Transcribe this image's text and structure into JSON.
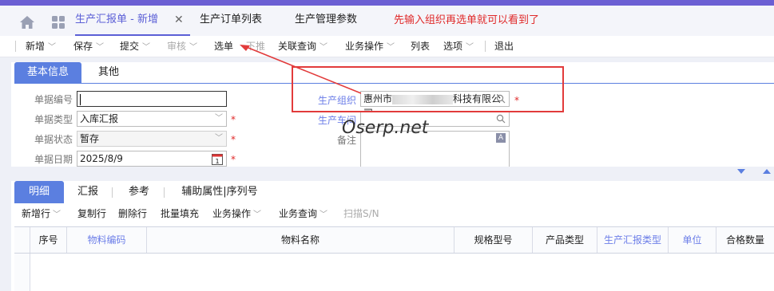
{
  "tabbar": {
    "home_icon": "home-icon",
    "apps_icon": "apps-grid-icon",
    "tabs": [
      {
        "label": "生产汇报单 - 新增",
        "active": true
      },
      {
        "label": "生产订单列表",
        "active": false
      },
      {
        "label": "生产管理参数",
        "active": false
      }
    ],
    "close_glyph": "✕",
    "tip": "先输入组织再选单就可以看到了"
  },
  "toolbar": {
    "items": [
      {
        "label": "新增",
        "chevron": true,
        "disabled": false
      },
      {
        "label": "保存",
        "chevron": true,
        "disabled": false
      },
      {
        "label": "提交",
        "chevron": true,
        "disabled": false
      },
      {
        "label": "审核",
        "chevron": true,
        "disabled": true
      },
      {
        "label": "选单",
        "chevron": false,
        "disabled": false
      },
      {
        "label": "下推",
        "chevron": false,
        "disabled": true
      },
      {
        "label": "关联查询",
        "chevron": true,
        "disabled": false
      },
      {
        "label": "业务操作",
        "chevron": true,
        "disabled": false
      },
      {
        "label": "列表",
        "chevron": false,
        "disabled": false
      },
      {
        "label": "选项",
        "chevron": true,
        "disabled": false
      },
      {
        "label": "退出",
        "chevron": false,
        "disabled": false
      }
    ]
  },
  "header_tabs": [
    "基本信息",
    "其他"
  ],
  "form": {
    "bill_no_label": "单据编号",
    "bill_no_value": "",
    "bill_type_label": "单据类型",
    "bill_type_value": "入库汇报",
    "bill_status_label": "单据状态",
    "bill_status_value": "暂存",
    "bill_date_label": "单据日期",
    "bill_date_value": "2025/8/9",
    "calendar_day": "1",
    "org_label": "生产组织",
    "org_value_prefix": "惠州市",
    "org_value_suffix": "科技有限公司",
    "workshop_label": "生产车间",
    "workshop_value": "",
    "remark_label": "备注",
    "required_mark": "*"
  },
  "watermark": "Oserp.net",
  "detail": {
    "tabs": [
      "明细",
      "汇报",
      "参考",
      "辅助属性|序列号"
    ],
    "toolbar": [
      {
        "label": "新增行",
        "chevron": true,
        "disabled": false
      },
      {
        "label": "复制行",
        "chevron": false,
        "disabled": false
      },
      {
        "label": "删除行",
        "chevron": false,
        "disabled": false
      },
      {
        "label": "批量填充",
        "chevron": false,
        "disabled": false
      },
      {
        "label": "业务操作",
        "chevron": true,
        "disabled": false
      },
      {
        "label": "业务查询",
        "chevron": true,
        "disabled": false
      },
      {
        "label": "扫描S/N",
        "chevron": false,
        "disabled": true
      }
    ],
    "columns": [
      {
        "label": "",
        "blue": false
      },
      {
        "label": "序号",
        "blue": false
      },
      {
        "label": "物料编码",
        "blue": true
      },
      {
        "label": "物料名称",
        "blue": false
      },
      {
        "label": "规格型号",
        "blue": false
      },
      {
        "label": "产品类型",
        "blue": false
      },
      {
        "label": "生产汇报类型",
        "blue": true
      },
      {
        "label": "单位",
        "blue": true
      },
      {
        "label": "合格数量",
        "blue": false
      }
    ]
  },
  "colors": {
    "accent": "#5b5fd6",
    "tab_blue": "#5b7fe0",
    "required": "#e02a2a",
    "annotation": "#e23b3b"
  }
}
